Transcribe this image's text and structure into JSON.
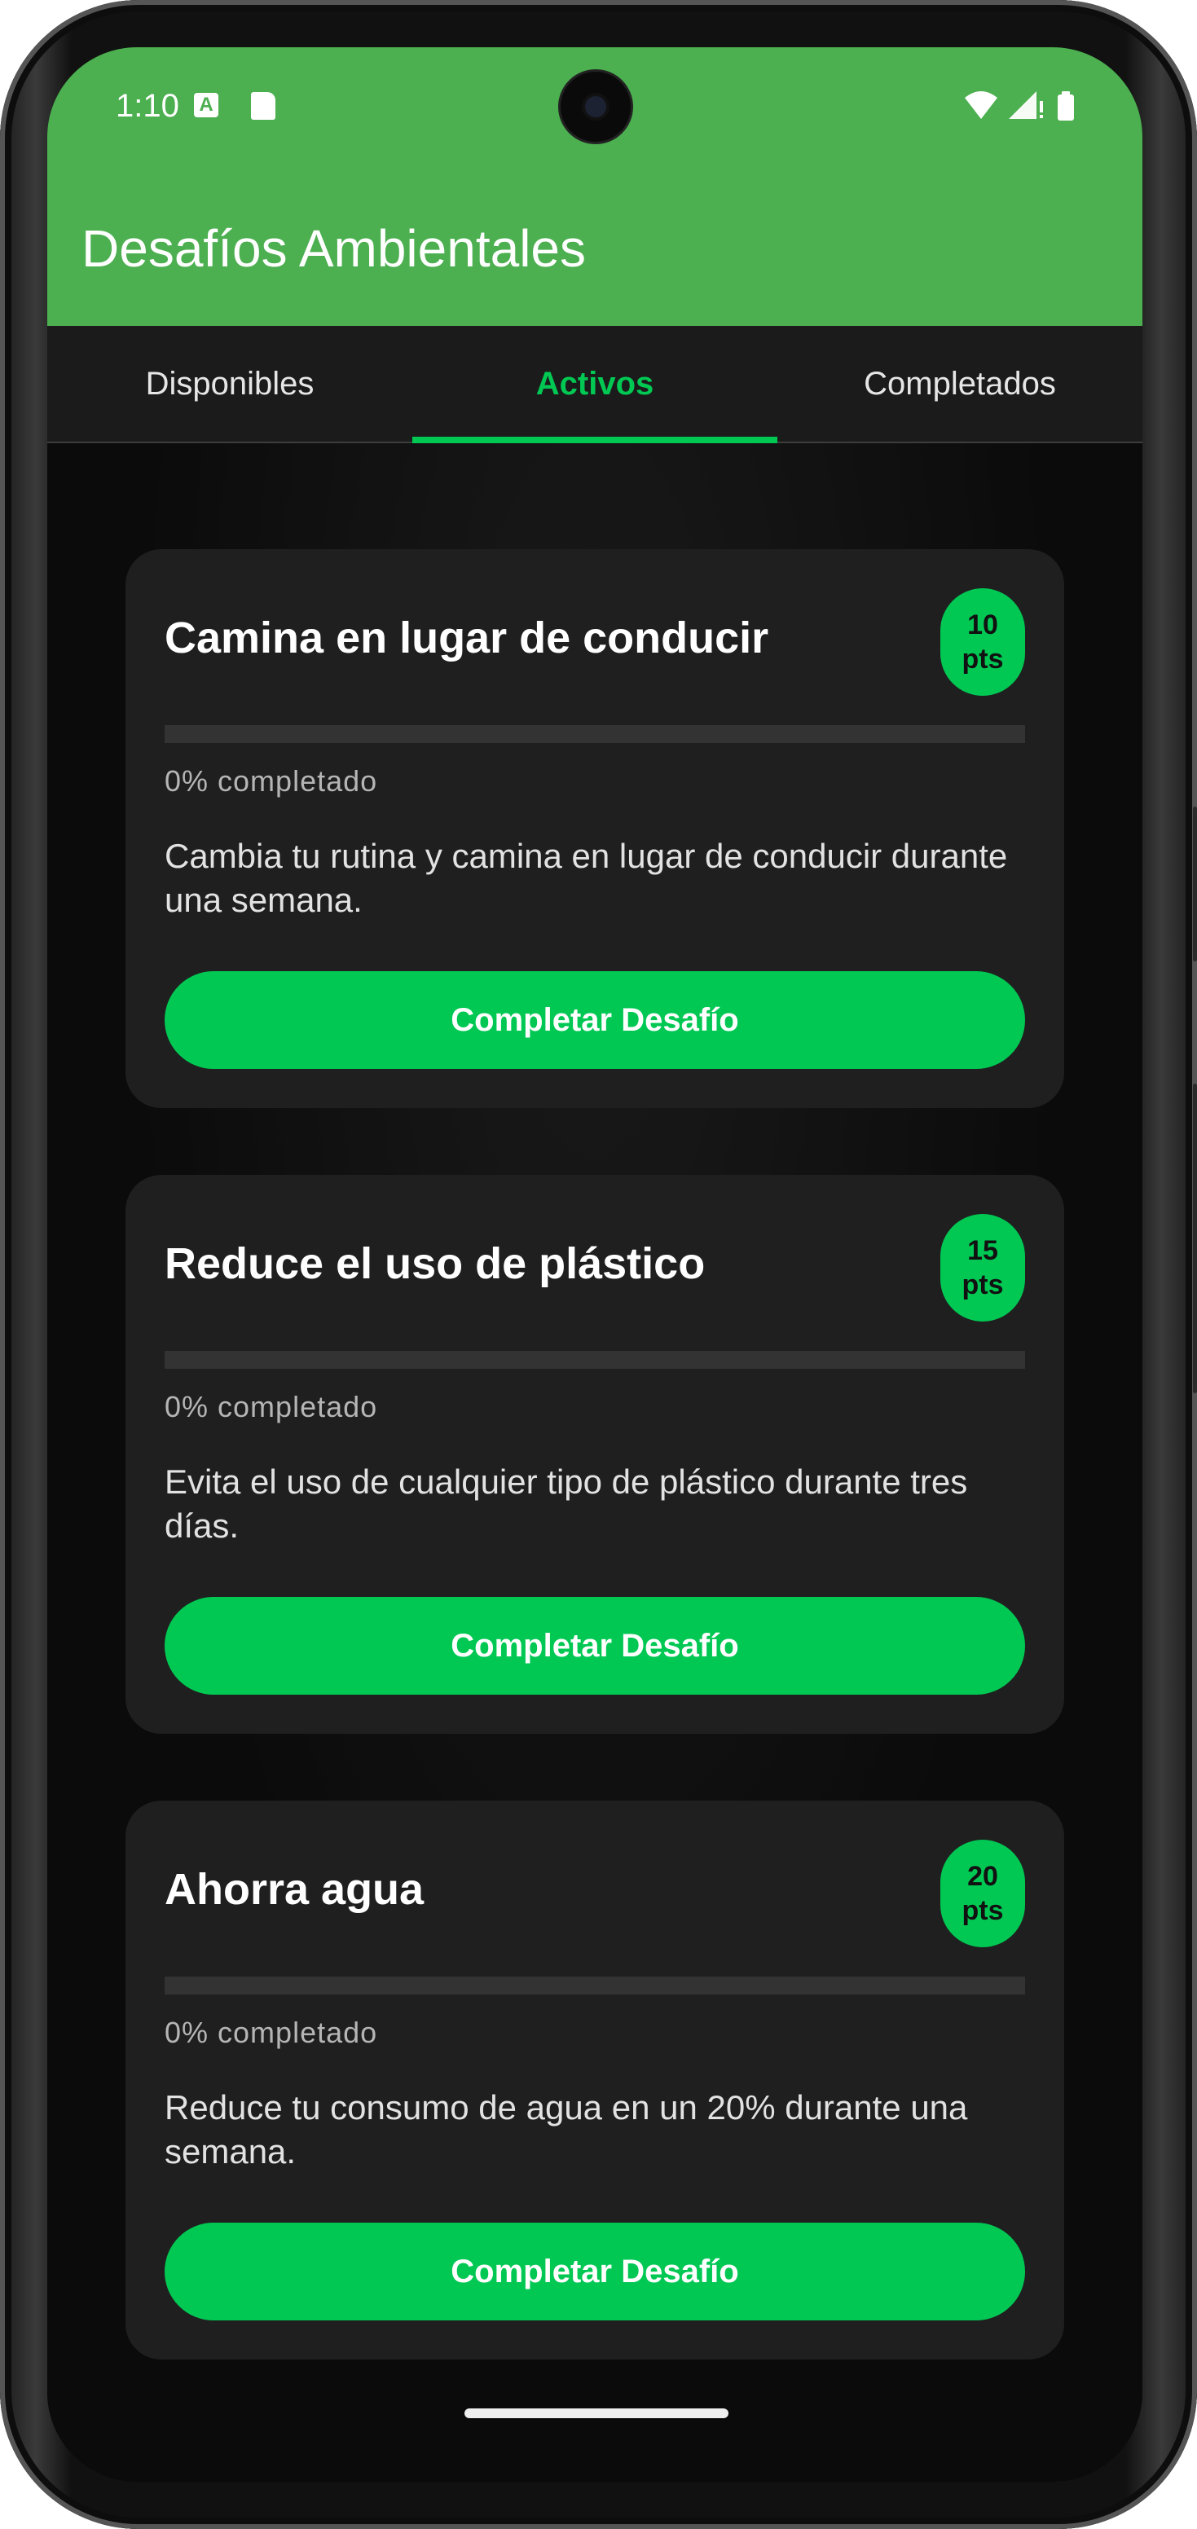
{
  "status_bar": {
    "time": "1:10"
  },
  "app_bar": {
    "title": "Desafíos Ambientales",
    "color": "#4caf50"
  },
  "tabs": [
    {
      "label": "Disponibles",
      "active": false
    },
    {
      "label": "Activos",
      "active": true
    },
    {
      "label": "Completados",
      "active": false
    }
  ],
  "challenges": [
    {
      "title": "Camina en lugar de conducir",
      "points_value": "10",
      "points_unit": "pts",
      "progress": 0,
      "progress_label": "0% completado",
      "description": "Cambia tu rutina y camina en lugar de conducir durante una semana.",
      "button_label": "Completar Desafío"
    },
    {
      "title": "Reduce el uso de plástico",
      "points_value": "15",
      "points_unit": "pts",
      "progress": 0,
      "progress_label": "0% completado",
      "description": "Evita el uso de cualquier tipo de plástico durante tres días.",
      "button_label": "Completar Desafío"
    },
    {
      "title": "Ahorra agua",
      "points_value": "20",
      "points_unit": "pts",
      "progress": 0,
      "progress_label": "0% completado",
      "description": "Reduce tu consumo de agua en un 20% durante una semana.",
      "button_label": "Completar Desafío"
    }
  ],
  "accent_color": "#00c853"
}
